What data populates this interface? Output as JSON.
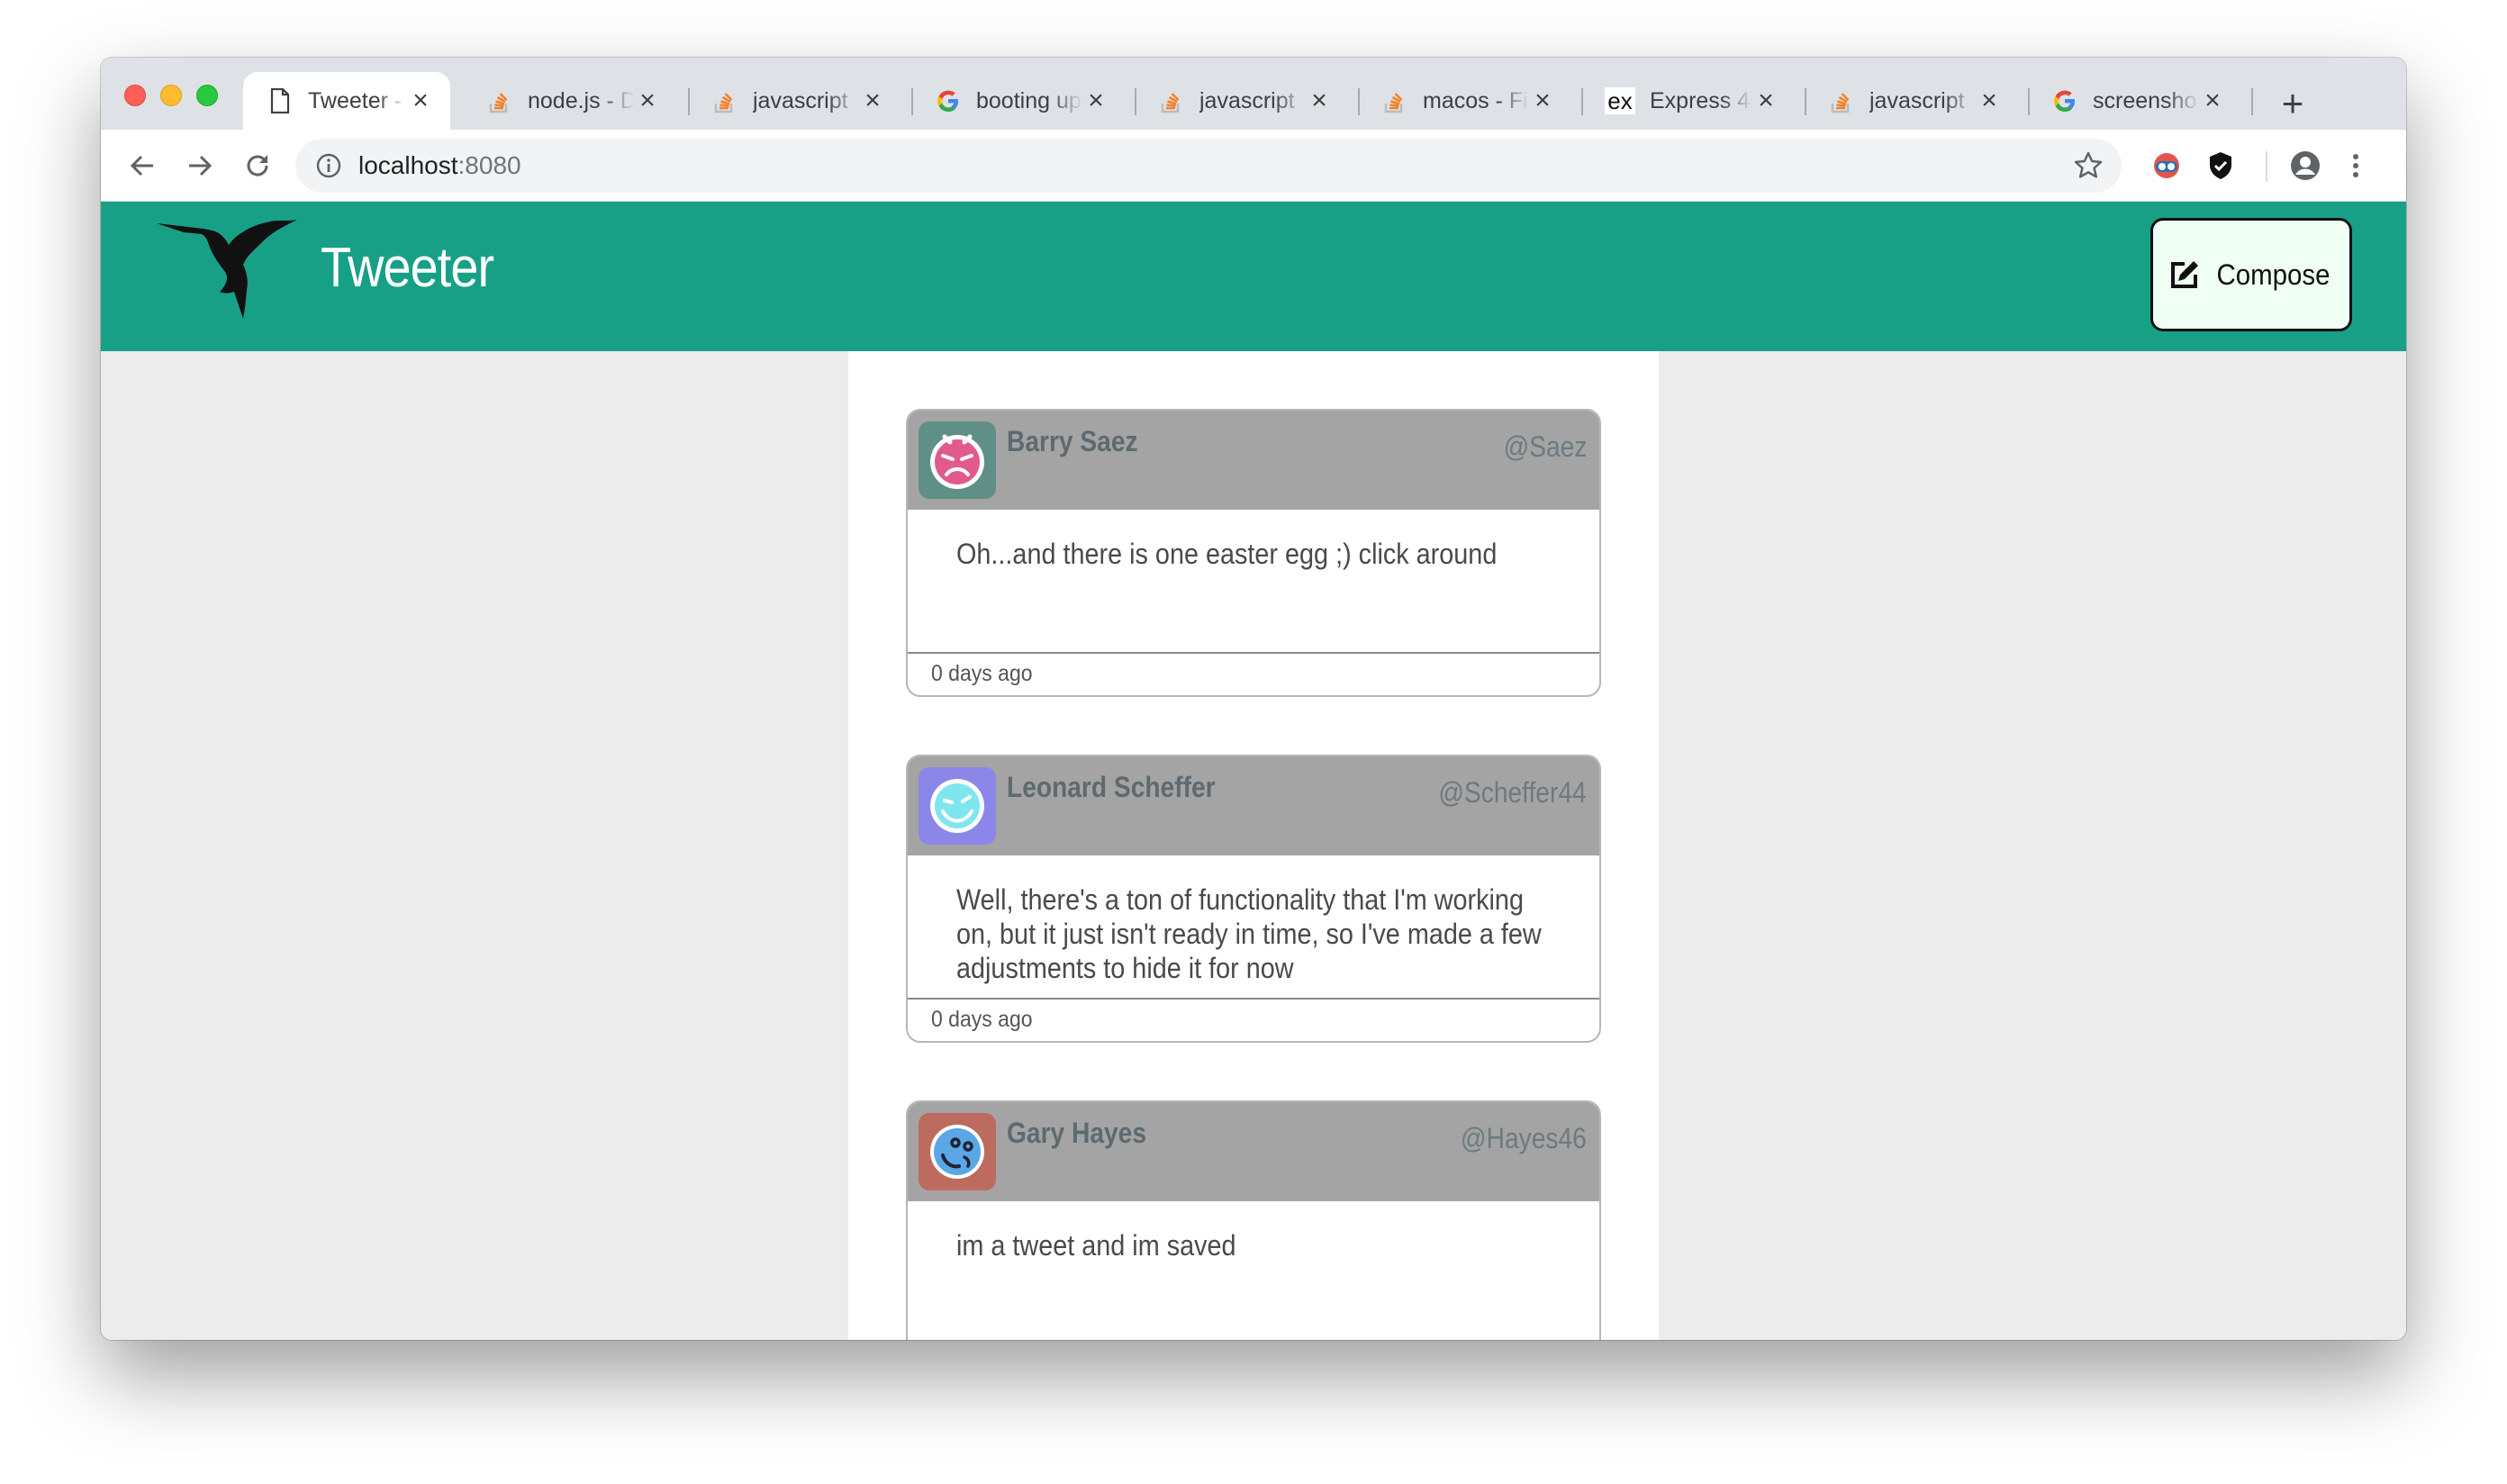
{
  "browser": {
    "tabs": [
      {
        "title": "Tweeter - ",
        "icon": "page-icon",
        "active": true
      },
      {
        "title": "node.js - D",
        "icon": "stackoverflow-icon"
      },
      {
        "title": "javascript",
        "icon": "stackoverflow-icon"
      },
      {
        "title": "booting up",
        "icon": "google-icon"
      },
      {
        "title": "javascript",
        "icon": "stackoverflow-icon"
      },
      {
        "title": "macos - Fi",
        "icon": "stackoverflow-icon"
      },
      {
        "title": "Express 4.",
        "icon": "express-icon"
      },
      {
        "title": "javascript",
        "icon": "stackoverflow-icon"
      },
      {
        "title": "screensho",
        "icon": "google-icon"
      }
    ],
    "address": {
      "host": "localhost",
      "port": ":8080"
    },
    "express_badge": "ex"
  },
  "header": {
    "brand": "Tweeter",
    "compose_label": "Compose"
  },
  "colors": {
    "header_bg": "#18a087",
    "tweet_header_bg": "#a4a4a4",
    "page_bg": "#ececec",
    "compose_bg": "#f0fff4"
  },
  "tweets": [
    {
      "name": "Barry Saez",
      "handle": "@Saez",
      "text": "Oh...and there is one easter egg ;) click around",
      "time": "0 days ago",
      "avatar_icon": "angry-face-icon",
      "avatar_bg": "#5f8f86",
      "avatar_face": "#e25a8d"
    },
    {
      "name": "Leonard Scheffer",
      "handle": "@Scheffer44",
      "text": "Well, there's a ton of functionality that I'm working on, but it just isn't ready in time, so I've made a few adjustments to hide it for now",
      "time": "0 days ago",
      "avatar_icon": "happy-face-icon",
      "avatar_bg": "#8b86e8",
      "avatar_face": "#7fe6f0"
    },
    {
      "name": "Gary Hayes",
      "handle": "@Hayes46",
      "text": "im a tweet and im saved",
      "time": "",
      "avatar_icon": "dizzy-face-icon",
      "avatar_bg": "#bd6b5e",
      "avatar_face": "#5aa6e6"
    }
  ]
}
